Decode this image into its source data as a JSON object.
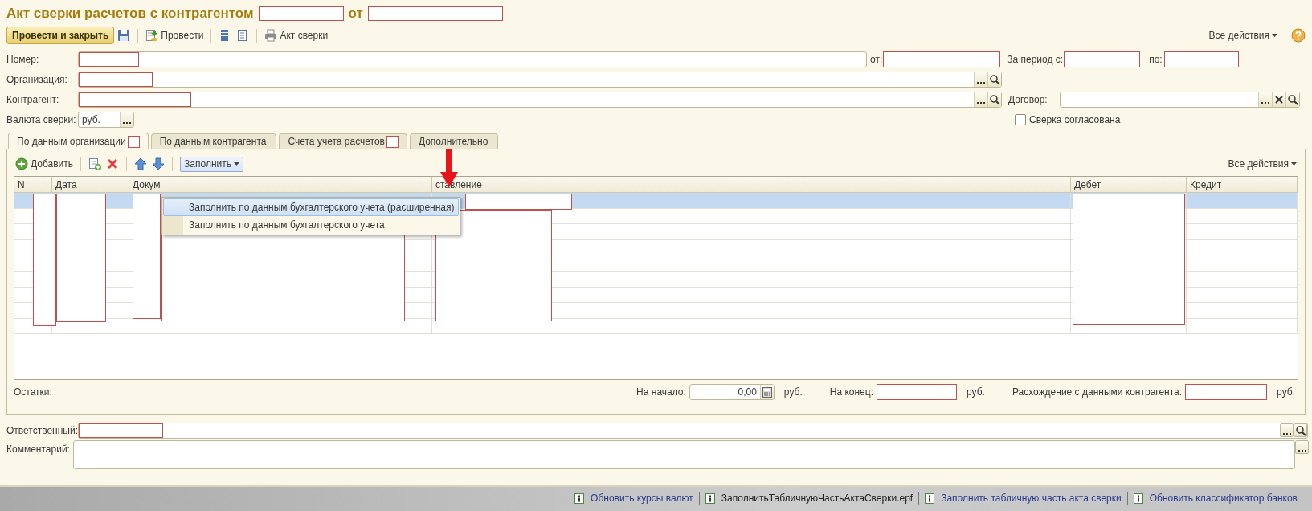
{
  "title": {
    "text": "Акт сверки расчетов с контрагентом",
    "number_redacted": true,
    "date_label": "от",
    "date_redacted": true
  },
  "toolbar": {
    "primary": "Провести и закрыть",
    "post": "Провести",
    "print": "Акт сверки",
    "all_actions": "Все действия"
  },
  "fields": {
    "number": {
      "label": "Номер:",
      "redacted": true
    },
    "date": {
      "label": "от:",
      "redacted": true
    },
    "period_from": {
      "label": "За период с:",
      "redacted": true
    },
    "period_to": {
      "label": "по:",
      "redacted": true
    },
    "organization": {
      "label": "Организация:",
      "redacted": true
    },
    "counterparty": {
      "label": "Контрагент:",
      "redacted": true
    },
    "contract": {
      "label": "Договор:"
    },
    "currency": {
      "label": "Валюта сверки:",
      "value": "руб."
    },
    "agreed": {
      "label": "Сверка согласована",
      "checked": false
    }
  },
  "tabs": [
    {
      "label": "По данным организации",
      "selected": true,
      "redacted": true
    },
    {
      "label": "По данным контрагента",
      "selected": false
    },
    {
      "label": "Счета учета расчетов",
      "selected": false,
      "redacted": true
    },
    {
      "label": "Дополнительно",
      "selected": false
    }
  ],
  "table_toolbar": {
    "add": "Добавить",
    "fill": "Заполнить",
    "all_actions": "Все действия"
  },
  "fill_menu": [
    {
      "label": "Заполнить по данным бухгалтерского учета (расширенная)",
      "selected": true
    },
    {
      "label": "Заполнить по данным бухгалтерского учета",
      "selected": false
    }
  ],
  "table": {
    "columns": [
      "N",
      "Дата",
      "Докум",
      "ставление",
      "Дебет",
      "Кредит"
    ],
    "redacted": true,
    "rows": [
      {
        "selected": true
      },
      {
        "selected": false
      },
      {
        "selected": false
      },
      {
        "selected": false
      },
      {
        "selected": false
      },
      {
        "selected": false
      },
      {
        "selected": false
      },
      {
        "selected": false
      },
      {
        "selected": false
      }
    ]
  },
  "balances": {
    "label": "Остатки:",
    "start": {
      "label": "На начало:",
      "value": "0,00",
      "unit": "руб."
    },
    "end": {
      "label": "На конец:",
      "unit": "руб.",
      "redacted": true
    },
    "difference": {
      "label": "Расхождение с данными контрагента:",
      "unit": "руб.",
      "redacted": true
    }
  },
  "responsible": {
    "label": "Ответственный:",
    "redacted": true
  },
  "comment": {
    "label": "Комментарий:"
  },
  "status_bar": [
    {
      "text": "Обновить курсы валют",
      "kind": "link"
    },
    {
      "text": "ЗаполнитьТабличнуюЧастьАктаСверки.epf",
      "kind": "file"
    },
    {
      "text": "Заполнить табличную часть акта сверки",
      "kind": "link"
    },
    {
      "text": "Обновить классификатор банков",
      "kind": "link"
    }
  ]
}
